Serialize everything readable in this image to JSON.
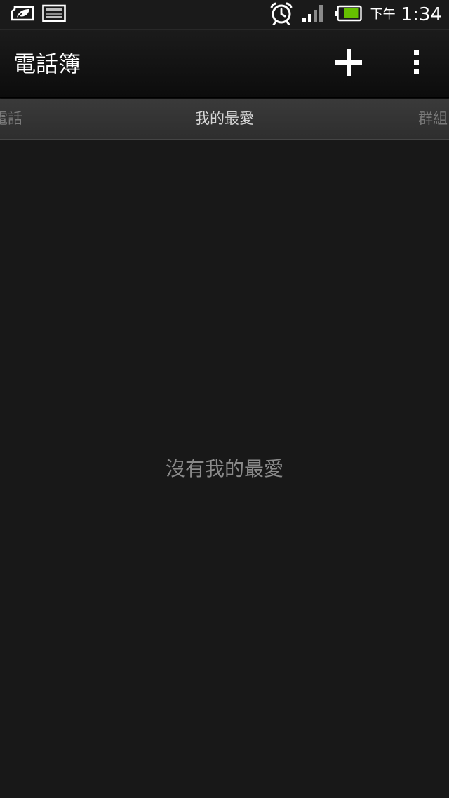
{
  "status_bar": {
    "ampm": "下午",
    "time": "1:34",
    "icons": [
      "power-saver-icon",
      "image-notification-icon",
      "alarm-icon",
      "signal-icon",
      "battery-icon"
    ],
    "battery_color": "#66c000"
  },
  "action_bar": {
    "title": "電話簿",
    "add_icon": "plus-icon",
    "menu_icon": "overflow-menu-icon"
  },
  "tabs": {
    "left": "電話",
    "center": "我的最愛",
    "right": "群組"
  },
  "content": {
    "empty_message": "沒有我的最愛"
  }
}
